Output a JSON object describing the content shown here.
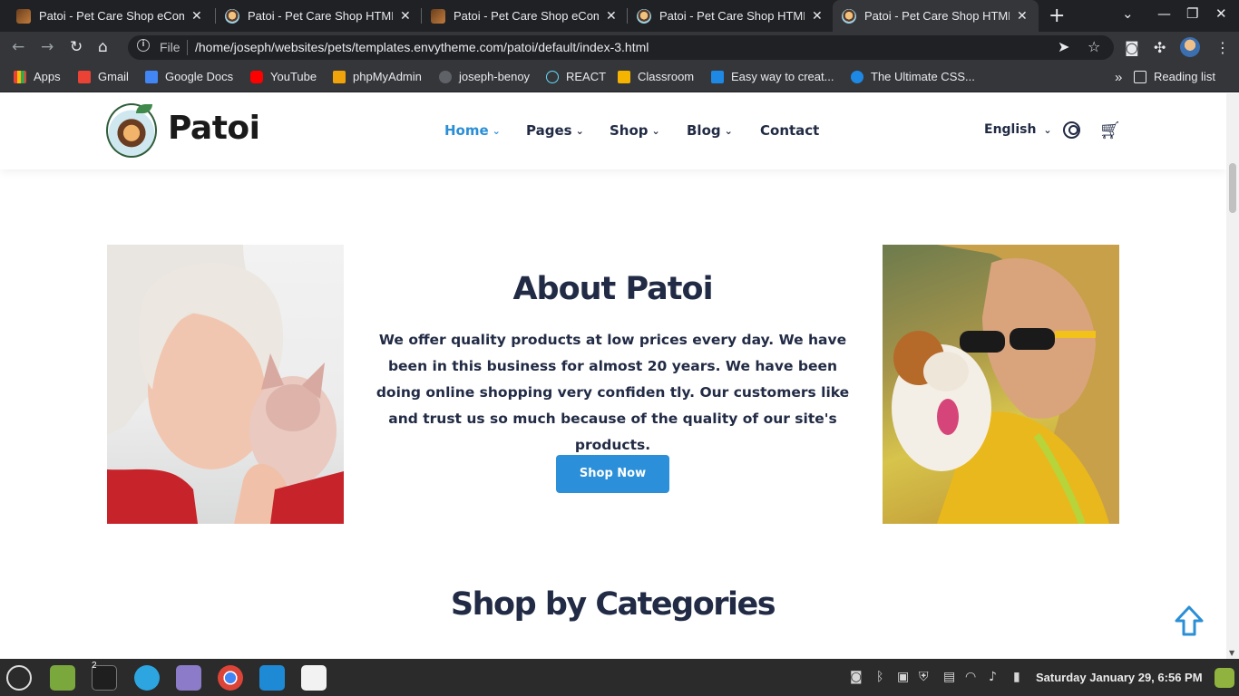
{
  "browser": {
    "tabs": [
      {
        "title": "Patoi - Pet Care Shop eCommerce",
        "favicon": "book-icon",
        "active": false
      },
      {
        "title": "Patoi - Pet Care Shop HTML Template",
        "favicon": "patoi-icon",
        "active": false
      },
      {
        "title": "Patoi - Pet Care Shop eCommerce",
        "favicon": "book-icon",
        "active": false
      },
      {
        "title": "Patoi - Pet Care Shop HTML Template",
        "favicon": "patoi-icon",
        "active": false
      },
      {
        "title": "Patoi - Pet Care Shop HTML Template",
        "favicon": "patoi-icon",
        "active": true
      }
    ],
    "omnibox": {
      "scheme_label": "File",
      "url": "/home/joseph/websites/pets/templates.envytheme.com/patoi/default/index-3.html"
    },
    "bookmarks": [
      {
        "label": "Apps",
        "color": "#8ab4f8"
      },
      {
        "label": "Gmail",
        "color": "#ea4335"
      },
      {
        "label": "Google Docs",
        "color": "#4285f4"
      },
      {
        "label": "YouTube",
        "color": "#ff0000"
      },
      {
        "label": "phpMyAdmin",
        "color": "#f0a30a"
      },
      {
        "label": "joseph-benoy",
        "color": "#bdc1c6"
      },
      {
        "label": "REACT",
        "color": "#61dafb"
      },
      {
        "label": "Classroom",
        "color": "#f4b400"
      },
      {
        "label": "Easy way to creat...",
        "color": "#1e88e5"
      },
      {
        "label": "The Ultimate CSS...",
        "color": "#1e88e5"
      }
    ],
    "reading_list_label": "Reading list"
  },
  "site": {
    "logo_text": "Patoi",
    "nav": [
      {
        "label": "Home",
        "active": true,
        "has_dropdown": true
      },
      {
        "label": "Pages",
        "active": false,
        "has_dropdown": true
      },
      {
        "label": "Shop",
        "active": false,
        "has_dropdown": true
      },
      {
        "label": "Blog",
        "active": false,
        "has_dropdown": true
      },
      {
        "label": "Contact",
        "active": false,
        "has_dropdown": false
      }
    ],
    "language": "English",
    "accent_color": "#2b8fd6",
    "heading_color": "#222b45"
  },
  "about": {
    "title": "About Patoi",
    "text": "We offer quality products at low prices every day. We have been in this business for almost 20 years. We have been doing online shopping very confiden tly. Our customers like and trust us so much because of the quality of our site's products.",
    "button_label": "Shop Now"
  },
  "categories": {
    "title": "Shop by Categories"
  },
  "taskbar": {
    "workspace_count": "2",
    "clock": "Saturday January 29,  6:56 PM"
  }
}
